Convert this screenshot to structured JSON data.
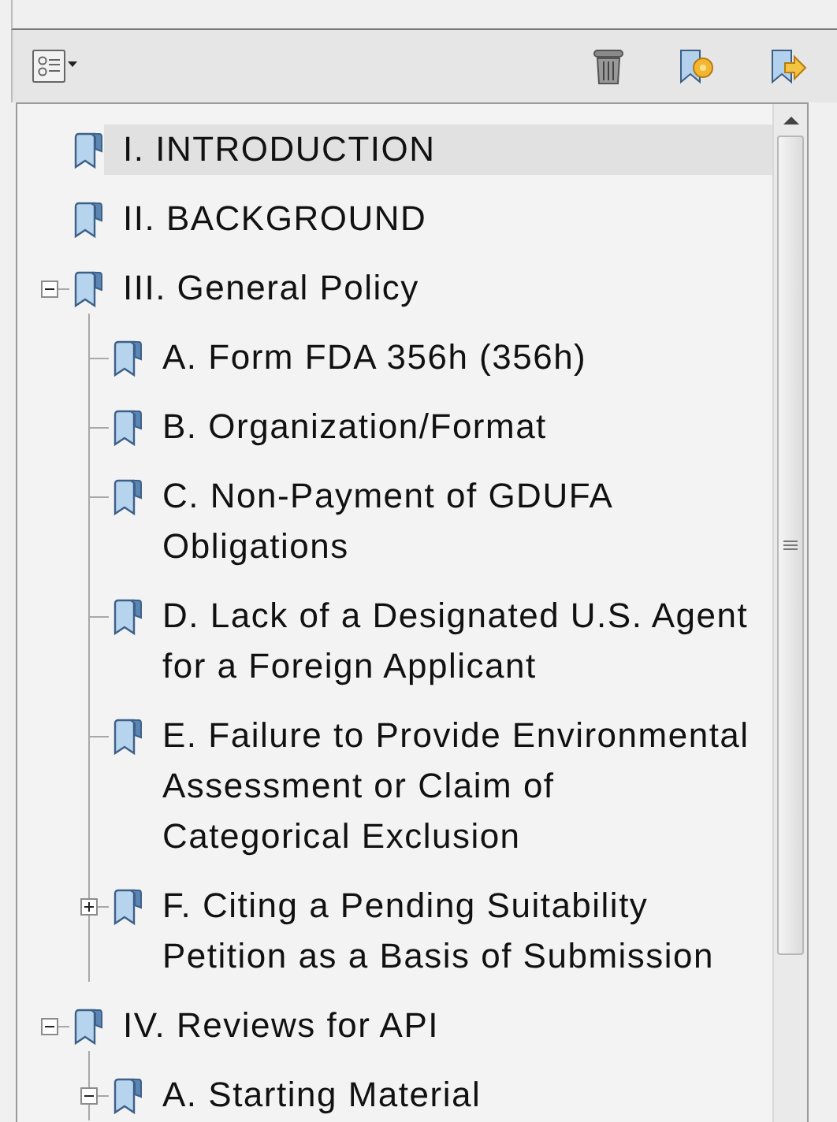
{
  "bookmarks": [
    {
      "label": "I. INTRODUCTION",
      "selected": true
    },
    {
      "label": "II. BACKGROUND",
      "selected": false
    },
    {
      "label": "III. General Policy",
      "selected": false,
      "expanded": true,
      "children": [
        {
          "label": "A. Form FDA 356h (356h)",
          "selected": false
        },
        {
          "label": "B. Organization/Format",
          "selected": false
        },
        {
          "label": "C. Non-Payment of GDUFA Obligations",
          "selected": false
        },
        {
          "label": "D. Lack of a Designated U.S. Agent for a Foreign Applicant",
          "selected": false
        },
        {
          "label": "E. Failure to Provide Environmental Assessment or Claim of Categorical Exclusion",
          "selected": false
        },
        {
          "label": "F. Citing a Pending Suitability Petition as a Basis of Submission",
          "selected": false,
          "expanded": false
        }
      ]
    },
    {
      "label": "IV. Reviews for API",
      "selected": false,
      "expanded": true,
      "children": [
        {
          "label": "A. Starting Material",
          "selected": false,
          "expanded": true
        }
      ]
    }
  ]
}
